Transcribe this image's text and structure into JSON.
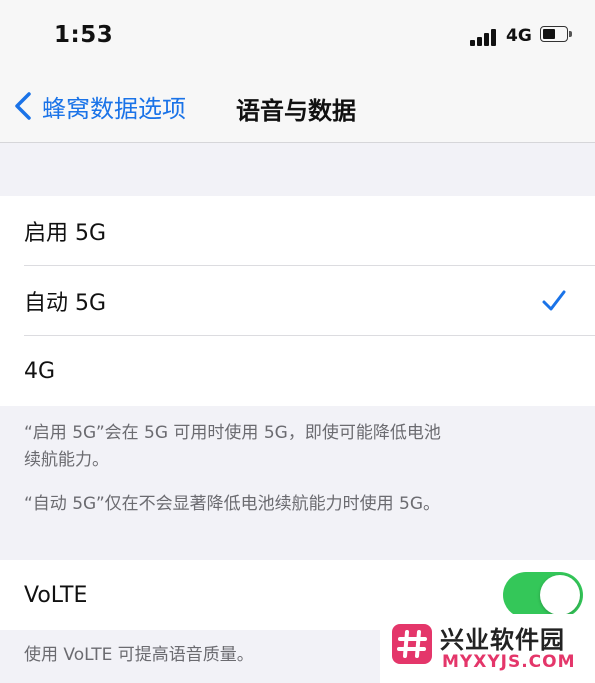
{
  "status_bar": {
    "time": "1:53",
    "network": "4G",
    "icons": [
      "signal-bars-icon",
      "battery-icon"
    ]
  },
  "nav": {
    "back_label": "蜂窝数据选项",
    "title": "语音与数据"
  },
  "options": [
    {
      "label": "启用 5G",
      "selected": false
    },
    {
      "label": "自动 5G",
      "selected": true
    },
    {
      "label": "4G",
      "selected": false
    }
  ],
  "footnote": {
    "line1": "“启用 5G”会在 5G 可用时使用 5G，即使可能降低电池",
    "line2": "续航能力。",
    "line3": "“自动 5G”仅在不会显著降低电池续航能力时使用 5G。"
  },
  "volte": {
    "label": "VoLTE",
    "enabled": true,
    "description": "使用 VoLTE 可提高语音质量。"
  },
  "watermark": {
    "name": "兴业软件园",
    "url": "MYXYJS.COM"
  },
  "colors": {
    "accent": "#1a73e8",
    "toggle_on": "#34c759",
    "watermark": "#e4366a"
  }
}
